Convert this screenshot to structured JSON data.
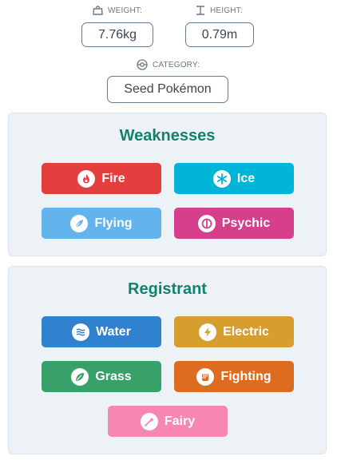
{
  "stats": {
    "weight": {
      "label": "WEIGHT:",
      "value": "7.76kg",
      "icon": "weight-icon"
    },
    "height": {
      "label": "HEIGHT:",
      "value": "0.79m",
      "icon": "height-icon"
    },
    "category": {
      "label": "CATEGORY:",
      "value": "Seed Pokémon",
      "icon": "pokeball-icon"
    }
  },
  "weaknesses": {
    "title": "Weaknesses",
    "types": [
      {
        "label": "Fire",
        "color": "#e53e3e",
        "icon": "fire-icon"
      },
      {
        "label": "Ice",
        "color": "#00b5d8",
        "icon": "snowflake-icon"
      },
      {
        "label": "Flying",
        "color": "#63b3ed",
        "icon": "feather-icon"
      },
      {
        "label": "Psychic",
        "color": "#d53f8c",
        "icon": "psychic-icon"
      }
    ]
  },
  "registrant": {
    "title": "Registrant",
    "types": [
      {
        "label": "Water",
        "color": "#3182ce",
        "icon": "water-icon"
      },
      {
        "label": "Electric",
        "color": "#d69e2e",
        "icon": "lightning-icon"
      },
      {
        "label": "Grass",
        "color": "#38a169",
        "icon": "leaf-icon"
      },
      {
        "label": "Fighting",
        "color": "#dd6b20",
        "icon": "fist-icon"
      },
      {
        "label": "Fairy",
        "color": "#f687b3",
        "icon": "fairy-icon"
      }
    ]
  }
}
